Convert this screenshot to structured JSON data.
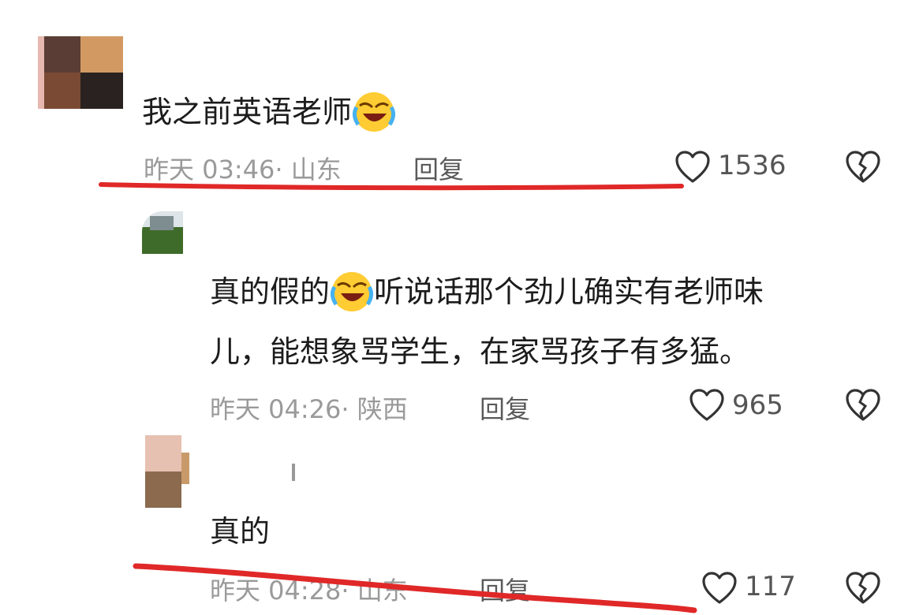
{
  "comments": [
    {
      "text_before": "我之前英语老师",
      "emoji": "loudly-crying-laughing-emoji",
      "time": "昨天 03:46",
      "location": "· 山东",
      "reply_label": "回复",
      "like_count": "1536"
    },
    {
      "line1_before": "真的假的",
      "emoji": "loudly-crying-laughing-emoji",
      "line1_after": "听说话那个劲儿确实有老师味",
      "line2": "儿，能想象骂学生，在家骂孩子有多猛。",
      "time": "昨天 04:26",
      "location": "· 陕西",
      "reply_label": "回复",
      "like_count": "965"
    },
    {
      "text": "真的",
      "time": "昨天 04:28",
      "location": "· 山东",
      "reply_label": "回复",
      "like_count": "117"
    }
  ],
  "annotation": {
    "color": "#e02828"
  }
}
